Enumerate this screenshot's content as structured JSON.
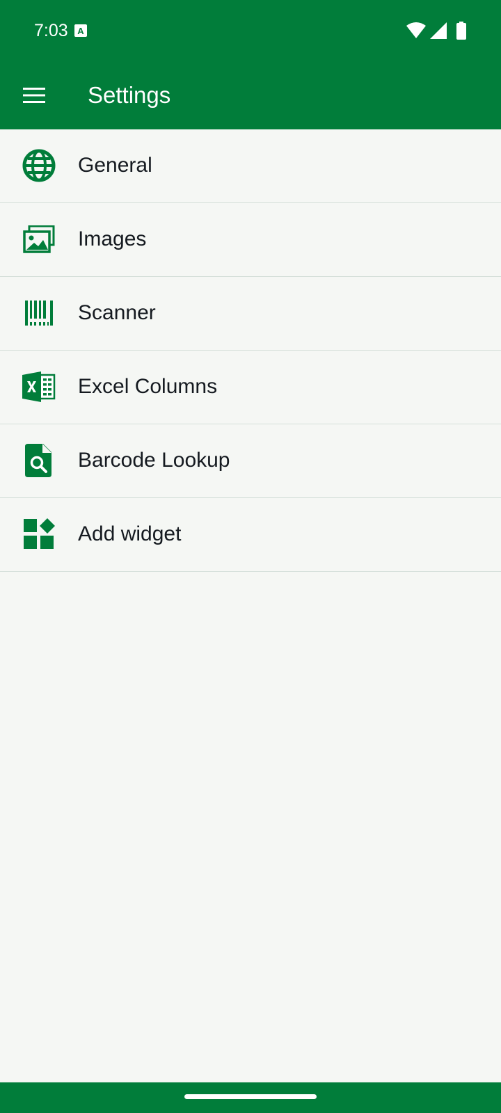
{
  "status_bar": {
    "time": "7:03",
    "notification_icon": "a-icon",
    "right_icons": [
      "wifi-icon",
      "signal-icon",
      "battery-icon"
    ]
  },
  "app_bar": {
    "title": "Settings",
    "nav_icon": "menu-icon"
  },
  "settings": {
    "items": [
      {
        "label": "General",
        "icon": "globe-icon"
      },
      {
        "label": "Images",
        "icon": "images-icon"
      },
      {
        "label": "Scanner",
        "icon": "barcode-icon"
      },
      {
        "label": "Excel Columns",
        "icon": "excel-icon"
      },
      {
        "label": "Barcode Lookup",
        "icon": "document-search-icon"
      },
      {
        "label": "Add widget",
        "icon": "widgets-icon"
      }
    ]
  },
  "colors": {
    "primary": "#017d3a",
    "background": "#f5f7f4",
    "divider": "#d5e0da",
    "text": "#151a20"
  }
}
